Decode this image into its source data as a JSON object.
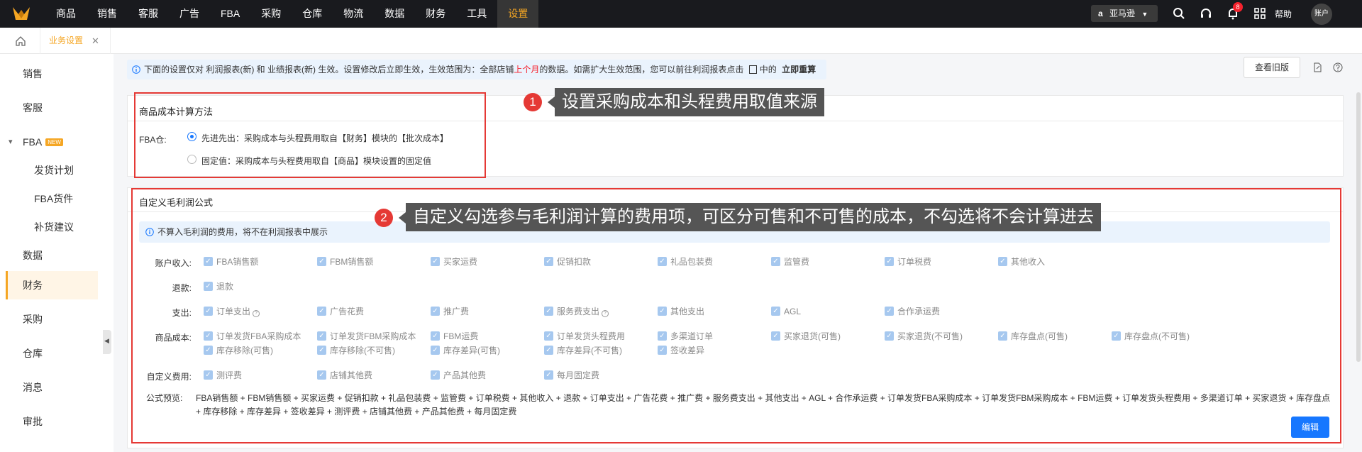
{
  "nav": {
    "items": [
      "商品",
      "销售",
      "客服",
      "广告",
      "FBA",
      "采购",
      "仓库",
      "物流",
      "数据",
      "财务",
      "工具",
      "设置"
    ],
    "active_index": 11,
    "marketplace": "亚马逊",
    "notification_count": "8",
    "help": "帮助",
    "account": "账户"
  },
  "tabs": {
    "active": "业务设置"
  },
  "sidebar": {
    "items": [
      {
        "label": "销售",
        "sub": false
      },
      {
        "label": "客服",
        "sub": false
      },
      {
        "label": "FBA",
        "sub": false,
        "badge": "NEW"
      },
      {
        "label": "发货计划",
        "sub": true
      },
      {
        "label": "FBA货件",
        "sub": true
      },
      {
        "label": "补货建议",
        "sub": true
      },
      {
        "label": "数据",
        "sub": false
      },
      {
        "label": "财务",
        "sub": false,
        "active": true
      },
      {
        "label": "采购",
        "sub": false
      },
      {
        "label": "仓库",
        "sub": false
      },
      {
        "label": "消息",
        "sub": false
      },
      {
        "label": "审批",
        "sub": false
      }
    ]
  },
  "notice": {
    "pre": "下面的设置仅对 利润报表(新) 和 业绩报表(新) 生效。设置修改后立即生效，生效范围为：全部店铺",
    "highlight": "上个月",
    "post": "的数据。如需扩大生效范围，您可以前往利润报表点击",
    "post2": "中的",
    "action": "立即重算"
  },
  "header_actions": {
    "old_version": "查看旧版"
  },
  "cost_section": {
    "title": "商品成本计算方法",
    "fba_label": "FBA仓:",
    "options": [
      {
        "label": "先进先出：采购成本与头程费用取自【财务】模块的【批次成本】",
        "selected": true
      },
      {
        "label": "固定值：采购成本与头程费用取自【商品】模块设置的固定值",
        "selected": false
      }
    ]
  },
  "callouts": {
    "one": {
      "num": "1",
      "text": "设置采购成本和头程费用取值来源"
    },
    "two": {
      "num": "2",
      "text": "自定义勾选参与毛利润计算的费用项，可区分可售和不可售的成本，不勾选将不会计算进去"
    }
  },
  "profit_section": {
    "title": "自定义毛利润公式",
    "info": "不算入毛利润的费用，将不在利润报表中展示",
    "rows": [
      {
        "label": "账户收入:",
        "items": [
          "FBA销售额",
          "FBM销售额",
          "买家运费",
          "促销扣款",
          "礼品包装费",
          "监管费",
          "订单税费",
          "其他收入"
        ]
      },
      {
        "label": "退款:",
        "items": [
          "退款"
        ]
      },
      {
        "label": "支出:",
        "items": [
          "订单支出",
          "广告花费",
          "推广费",
          "服务费支出",
          "其他支出",
          "AGL",
          "合作承运费"
        ]
      },
      {
        "label": "商品成本:",
        "items": [
          "订单发货FBA采购成本",
          "订单发货FBM采购成本",
          "FBM运费",
          "订单发货头程费用",
          "多渠道订单",
          "买家退货(可售)",
          "买家退货(不可售)",
          "库存盘点(可售)",
          "库存盘点(不可售)",
          "库存移除(可售)",
          "库存移除(不可售)",
          "库存差异(可售)",
          "库存差异(不可售)",
          "签收差异"
        ]
      },
      {
        "label": "自定义费用:",
        "items": [
          "测评费",
          "店铺其他费",
          "产品其他费",
          "每月固定费"
        ]
      }
    ],
    "formula_label": "公式预览:",
    "formula": "FBA销售额 + FBM销售额 + 买家运费 + 促销扣款 + 礼品包装费 + 监管费 + 订单税费 + 其他收入 + 退款 + 订单支出 + 广告花费 + 推广费 + 服务费支出 + 其他支出 + AGL + 合作承运费 + 订单发货FBA采购成本 + 订单发货FBM采购成本 + FBM运费 + 订单发货头程费用 + 多渠道订单 + 买家退货 + 库存盘点 + 库存移除 + 库存差异 + 签收差异 + 测评费 + 店铺其他费 + 产品其他费 + 每月固定费",
    "edit": "编辑"
  }
}
